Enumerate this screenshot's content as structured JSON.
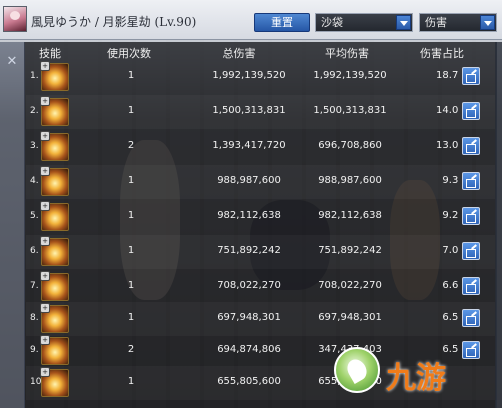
{
  "header": {
    "title": "風見ゆうか / 月影星劫 (Lv.90)",
    "reset_label": "重置",
    "target_select": "沙袋",
    "metric_select": "伤害"
  },
  "columns": {
    "skill": "技能",
    "uses": "使用次数",
    "total": "总伤害",
    "avg": "平均伤害",
    "share": "伤害占比"
  },
  "rows": [
    {
      "rank": "1.",
      "uses": "1",
      "total": "1,992,139,520",
      "avg": "1,992,139,520",
      "share": "18.7 %"
    },
    {
      "rank": "2.",
      "uses": "1",
      "total": "1,500,313,831",
      "avg": "1,500,313,831",
      "share": "14.0 %"
    },
    {
      "rank": "3.",
      "uses": "2",
      "total": "1,393,417,720",
      "avg": "696,708,860",
      "share": "13.0 %"
    },
    {
      "rank": "4.",
      "uses": "1",
      "total": "988,987,600",
      "avg": "988,987,600",
      "share": "9.3 %"
    },
    {
      "rank": "5.",
      "uses": "1",
      "total": "982,112,638",
      "avg": "982,112,638",
      "share": "9.2 %"
    },
    {
      "rank": "6.",
      "uses": "1",
      "total": "751,892,242",
      "avg": "751,892,242",
      "share": "7.0 %"
    },
    {
      "rank": "7.",
      "uses": "1",
      "total": "708,022,270",
      "avg": "708,022,270",
      "share": "6.6 %"
    },
    {
      "rank": "8.",
      "uses": "1",
      "total": "697,948,301",
      "avg": "697,948,301",
      "share": "6.5 %"
    },
    {
      "rank": "9.",
      "uses": "2",
      "total": "694,874,806",
      "avg": "347,437,403",
      "share": "6.5 %"
    },
    {
      "rank": "10.",
      "uses": "1",
      "total": "655,805,600",
      "avg": "655,805,600",
      "share": ""
    }
  ],
  "watermark": {
    "text": "九游"
  },
  "icons": {
    "close": "close-icon",
    "share": "share-icon",
    "dropdown": "chevron-down-icon",
    "skill": "skill-icon"
  },
  "colors": {
    "reset_button": "#2f64b8",
    "panel_bg": "#0c0e12",
    "watermark_orange": "#f07c1a"
  }
}
